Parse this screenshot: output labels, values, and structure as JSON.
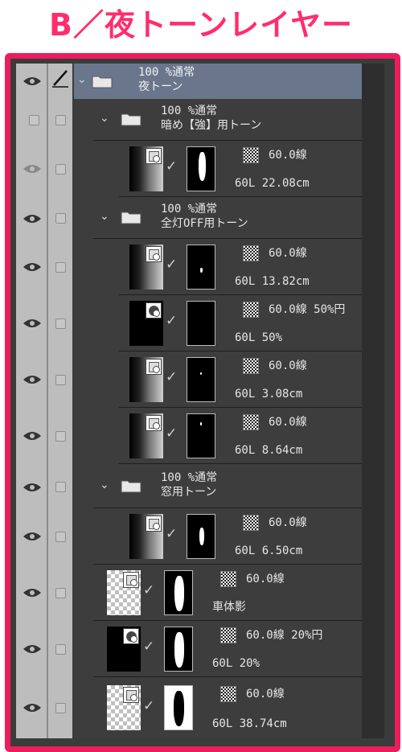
{
  "title": "B／夜トーンレイヤー",
  "colors": {
    "title": "#ff2d6d",
    "frame": "#ec1d5c",
    "header_row": "#6a768c",
    "panel": "#3d3d3d"
  },
  "folders": [
    {
      "line1": "100 %通常",
      "line2": "夜トーン"
    },
    {
      "line1": "100 %通常",
      "line2": "暗め【強】用トーン"
    },
    {
      "line1": "100 %通常",
      "line2": "全灯OFF用トーン"
    },
    {
      "line1": "100 %通常",
      "line2": "窓用トーン"
    }
  ],
  "layers": [
    {
      "line1": "60.0線",
      "line2": "60L 22.08cm"
    },
    {
      "line1": "60.0線",
      "line2": "60L 13.82cm"
    },
    {
      "line1": "60.0線 50%円",
      "line2": "60L 50%"
    },
    {
      "line1": "60.0線",
      "line2": "60L 3.08cm"
    },
    {
      "line1": "60.0線",
      "line2": "60L 8.64cm"
    },
    {
      "line1": "60.0線",
      "line2": "60L 6.50cm"
    },
    {
      "line1": "60.0線",
      "line2": "車体影"
    },
    {
      "line1": "60.0線 20%円",
      "line2": "60L 20%"
    },
    {
      "line1": "60.0線",
      "line2": "60L 38.74cm"
    }
  ]
}
